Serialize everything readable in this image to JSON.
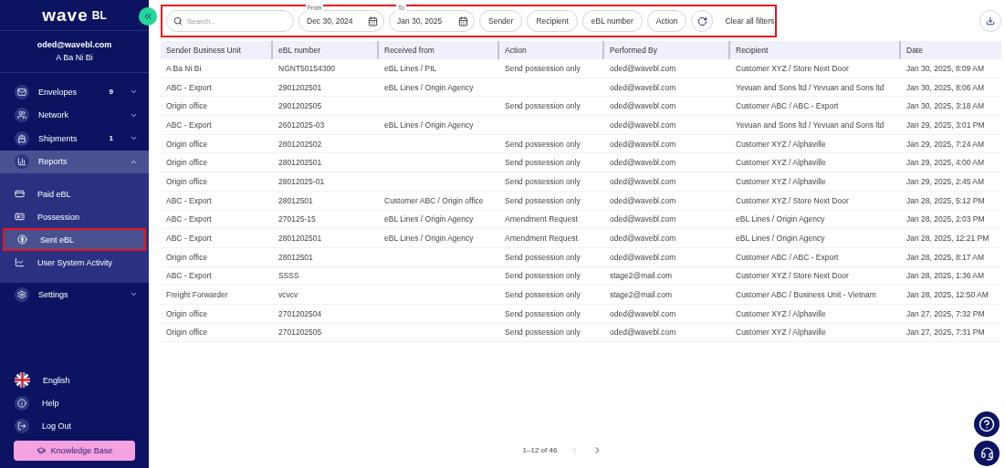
{
  "sidebar": {
    "logo": {
      "main": "wave",
      "suffix": "BL"
    },
    "user": {
      "email": "oded@wavebl.com",
      "name": "A Ba Ni Bi"
    },
    "nav": [
      {
        "label": "Envelopes",
        "badge": "9",
        "expanded": false
      },
      {
        "label": "Network",
        "expanded": false
      },
      {
        "label": "Shipments",
        "badge": "1",
        "expanded": false
      },
      {
        "label": "Reports",
        "expanded": true,
        "children": [
          {
            "label": "Paid eBL",
            "selected": false,
            "highlighted": false
          },
          {
            "label": "Possession",
            "selected": false,
            "highlighted": false
          },
          {
            "label": "Sent eBL",
            "selected": true,
            "highlighted": true
          },
          {
            "label": "User System Activity",
            "selected": false,
            "highlighted": false
          }
        ]
      },
      {
        "label": "Settings",
        "expanded": false
      }
    ],
    "footer": [
      {
        "label": "English"
      },
      {
        "label": "Help"
      },
      {
        "label": "Log Out"
      }
    ],
    "knowledge_base": "Knowledge Base"
  },
  "filters": {
    "highlighted": true,
    "search": {
      "placeholder": "Search..."
    },
    "from": {
      "label": "From",
      "value": "Dec 30, 2024"
    },
    "to": {
      "label": "To",
      "value": "Jan 30, 2025"
    },
    "chips": [
      "Sender",
      "Recipient",
      "eBL number",
      "Action"
    ],
    "clear": "Clear all filters"
  },
  "table": {
    "columns": [
      "Sender Business Unit",
      "eBL number",
      "Received from",
      "Action",
      "Performed By",
      "Recipient",
      "Date"
    ],
    "rows": [
      [
        "A Ba Ni Bi",
        "NGNT50154300",
        "eBL Lines / PIL",
        "Send possession only",
        "oded@wavebl.com",
        "Customer XYZ / Store Next Door",
        "Jan 30, 2025, 8:09 AM"
      ],
      [
        "ABC - Export",
        "2901202501",
        "eBL Lines / Origin Agency",
        "",
        "oded@wavebl.com",
        "Yevuan and Sons ltd / Yevuan and Sons ltd",
        "Jan 30, 2025, 8:06 AM"
      ],
      [
        "Origin office",
        "2901202505",
        "",
        "Send possession only",
        "oded@wavebl.com",
        "Customer ABC / ABC - Export",
        "Jan 30, 2025, 3:18 AM"
      ],
      [
        "ABC - Export",
        "26012025-03",
        "eBL Lines / Origin Agency",
        "",
        "oded@wavebl.com",
        "Yevuan and Sons ltd / Yevuan and Sons ltd",
        "Jan 29, 2025, 3:01 PM"
      ],
      [
        "Origin office",
        "2801202502",
        "",
        "Send possession only",
        "oded@wavebl.com",
        "Customer XYZ / Alphaville",
        "Jan 29, 2025, 7:24 AM"
      ],
      [
        "Origin office",
        "2801202501",
        "",
        "Send possession only",
        "oded@wavebl.com",
        "Customer XYZ / Alphaville",
        "Jan 29, 2025, 4:00 AM"
      ],
      [
        "Origin office",
        "28012025-01",
        "",
        "Send possession only",
        "oded@wavebl.com",
        "Customer XYZ / Alphaville",
        "Jan 29, 2025, 2:45 AM"
      ],
      [
        "ABC - Export",
        "28012501",
        "Customer ABC / Origin office",
        "Send possession only",
        "oded@wavebl.com",
        "Customer XYZ / Store Next Door",
        "Jan 28, 2025, 5:12 PM"
      ],
      [
        "ABC - Export",
        "270125-15",
        "eBL Lines / Origin Agency",
        "Amendment Request",
        "oded@wavebl.com",
        "eBL Lines / Origin Agency",
        "Jan 28, 2025, 2:03 PM"
      ],
      [
        "ABC - Export",
        "2801202501",
        "eBL Lines / Origin Agency",
        "Amendment Request",
        "oded@wavebl.com",
        "eBL Lines / Origin Agency",
        "Jan 28, 2025, 12:21 PM"
      ],
      [
        "Origin office",
        "28012501",
        "",
        "Send possession only",
        "oded@wavebl.com",
        "Customer ABC / ABC - Export",
        "Jan 28, 2025, 8:17 AM"
      ],
      [
        "ABC - Export",
        "SSSS",
        "",
        "Send possession only",
        "stage2@mail.com",
        "Customer XYZ / Store Next Door",
        "Jan 28, 2025, 1:36 AM"
      ],
      [
        "Freight Forwarder",
        "vcvcv",
        "",
        "Send possession only",
        "stage2@mail.com",
        "Customer ABC / Business Unit - Vietnam",
        "Jan 28, 2025, 12:50 AM"
      ],
      [
        "Origin office",
        "2701202504",
        "",
        "Send possession only",
        "oded@wavebl.com",
        "Customer XYZ / Alphaville",
        "Jan 27, 2025, 7:32 PM"
      ],
      [
        "Origin office",
        "2701202505",
        "",
        "Send possession only",
        "oded@wavebl.com",
        "Customer XYZ / Alphaville",
        "Jan 27, 2025, 7:31 PM"
      ]
    ]
  },
  "pagination": {
    "range": "1–12 of 46",
    "prev_disabled": true,
    "next_disabled": false
  }
}
